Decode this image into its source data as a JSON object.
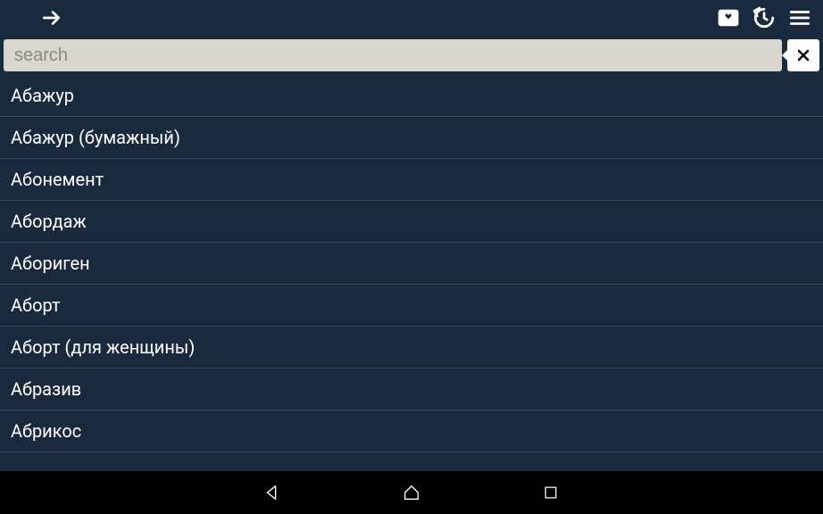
{
  "search": {
    "placeholder": "search",
    "value": ""
  },
  "words": [
    "Абажур",
    "Абажур (бумажный)",
    "Абонемент",
    "Абордаж",
    "Абориген",
    "Аборт",
    "Аборт (для женщины)",
    "Абразив",
    "Абрикос"
  ]
}
